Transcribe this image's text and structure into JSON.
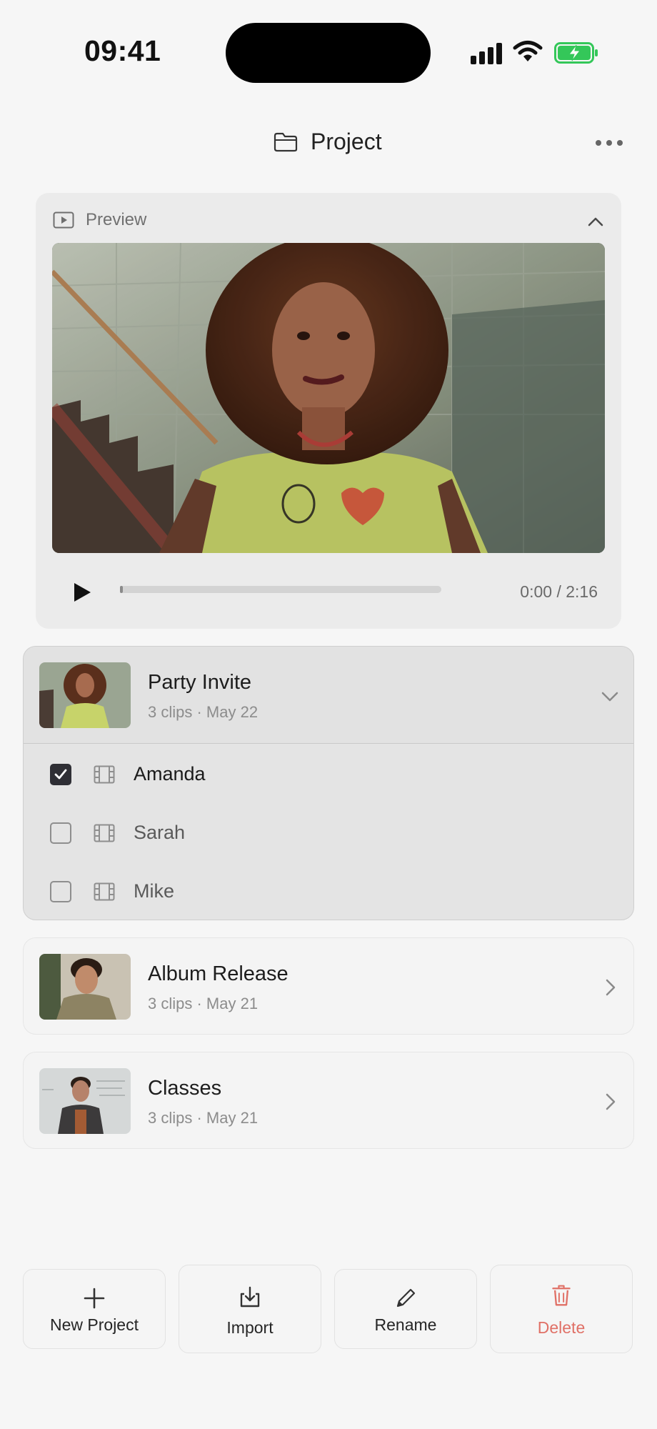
{
  "status_bar": {
    "time": "09:41"
  },
  "header": {
    "title": "Project"
  },
  "preview": {
    "label": "Preview",
    "time_readout": "0:00 / 2:16",
    "progress": 0.0
  },
  "projects": [
    {
      "title": "Party Invite",
      "meta": "3 clips · May 22",
      "expanded": true,
      "clips": [
        {
          "name": "Amanda",
          "checked": true
        },
        {
          "name": "Sarah",
          "checked": false
        },
        {
          "name": "Mike",
          "checked": false
        }
      ]
    },
    {
      "title": "Album Release",
      "meta": "3 clips · May 21",
      "expanded": false
    },
    {
      "title": "Classes",
      "meta": "3 clips · May 21",
      "expanded": false
    }
  ],
  "toolbar": {
    "new_project": "New Project",
    "import": "Import",
    "rename": "Rename",
    "delete": "Delete"
  },
  "colors": {
    "danger": "#e07066",
    "battery_green": "#34c759",
    "checkbox_dark": "#2f2f35"
  }
}
